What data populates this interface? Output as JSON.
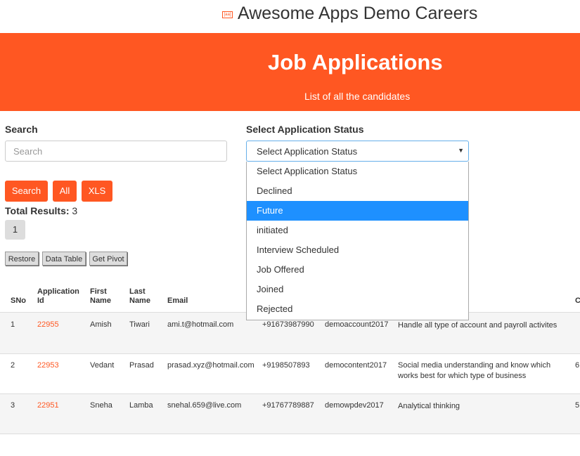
{
  "brand": {
    "logo_text": "[aa]",
    "title": "Awesome Apps Demo Careers"
  },
  "hero": {
    "title": "Job Applications",
    "subtitle": "List of all the candidates"
  },
  "search": {
    "label": "Search",
    "placeholder": "Search",
    "value": ""
  },
  "status_filter": {
    "label": "Select Application Status",
    "selected": "Select Application Status",
    "options": [
      "Select Application Status",
      "Declined",
      "Future",
      "initiated",
      "Interview Scheduled",
      "Job Offered",
      "Joined",
      "Rejected"
    ],
    "highlighted": "Future"
  },
  "actions": {
    "search": "Search",
    "all": "All",
    "xls": "XLS"
  },
  "results": {
    "total_label": "Total Results:",
    "total": "3"
  },
  "pagination": {
    "pages": [
      "1"
    ]
  },
  "grid_actions": {
    "restore": "Restore",
    "data_table": "Data Table",
    "get_pivot": "Get Pivot"
  },
  "table": {
    "headers": [
      "SNo",
      "Application Id",
      "First Name",
      "Last Name",
      "Email",
      "",
      "",
      "",
      "C"
    ],
    "rows": [
      {
        "sno": "1",
        "app_id": "22955",
        "first": "Amish",
        "last": "Tiwari",
        "email": "ami.t@hotmail.com",
        "phone": "+91673987990",
        "account": "demoaccount2017",
        "skills": "Handle all type of account and payroll activites",
        "extra": ""
      },
      {
        "sno": "2",
        "app_id": "22953",
        "first": "Vedant",
        "last": "Prasad",
        "email": "prasad.xyz@hotmail.com",
        "phone": "+9198507893",
        "account": "democontent2017",
        "skills": "Social media understanding and know which works best for which type of business",
        "extra": "6"
      },
      {
        "sno": "3",
        "app_id": "22951",
        "first": "Sneha",
        "last": "Lamba",
        "email": "snehal.659@live.com",
        "phone": "+91767789887",
        "account": "demowpdev2017",
        "skills": "Analytical thinking",
        "extra": "5"
      }
    ]
  },
  "colors": {
    "accent": "#ff5722",
    "highlight": "#1e90ff",
    "row_alt": "#f5f5f5"
  }
}
